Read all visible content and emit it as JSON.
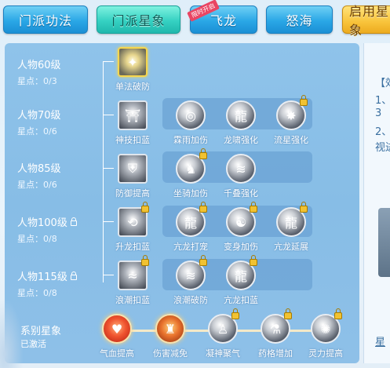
{
  "tabs": [
    {
      "label": "门派功法",
      "style": "blue"
    },
    {
      "label": "门派星象",
      "style": "active"
    },
    {
      "label": "飞龙",
      "style": "blue",
      "badge": "限时开启"
    },
    {
      "label": "怒海",
      "style": "blue"
    },
    {
      "label": "启用星象",
      "style": "yellow"
    }
  ],
  "rows": [
    {
      "level": "人物60级",
      "stars": "星点：0/3",
      "locked": false,
      "nodes": [
        {
          "label": "单法破防",
          "icon": "sword-burst-icon",
          "locked": false
        }
      ]
    },
    {
      "level": "人物70级",
      "stars": "星点：0/6",
      "locked": false,
      "nodes": [
        {
          "label": "神技扣蓝",
          "icon": "pagoda-icon",
          "locked": false
        },
        {
          "label": "霖雨加伤",
          "icon": "swirl-icon",
          "locked": false
        },
        {
          "label": "龙啸强化",
          "icon": "dragon-head-icon",
          "locked": false
        },
        {
          "label": "流星强化",
          "icon": "meteor-icon",
          "locked": true
        }
      ]
    },
    {
      "level": "人物85级",
      "stars": "星点：0/6",
      "locked": false,
      "nodes": [
        {
          "label": "防御提高",
          "icon": "shield-icon",
          "locked": false
        },
        {
          "label": "坐骑加伤",
          "icon": "mount-icon",
          "locked": true
        },
        {
          "label": "千叠强化",
          "icon": "wave-icon",
          "locked": false
        }
      ]
    },
    {
      "level": "人物100级",
      "stars": "星点：0/8",
      "locked": true,
      "nodes": [
        {
          "label": "升龙扣蓝",
          "icon": "rising-dragon-icon",
          "locked": true
        },
        {
          "label": "亢龙打宠",
          "icon": "coiled-dragon-icon",
          "locked": true
        },
        {
          "label": "变身加伤",
          "icon": "transform-icon",
          "locked": true
        },
        {
          "label": "亢龙延展",
          "icon": "dragon-extend-icon",
          "locked": true
        }
      ]
    },
    {
      "level": "人物115级",
      "stars": "星点：0/8",
      "locked": true,
      "nodes": [
        {
          "label": "浪潮扣蓝",
          "icon": "tide-icon",
          "locked": true
        },
        {
          "label": "浪潮破防",
          "icon": "tide-break-icon",
          "locked": true
        },
        {
          "label": "亢龙扣蓝",
          "icon": "dragon-mana-icon",
          "locked": true
        }
      ]
    }
  ],
  "series": {
    "title": "系别星象",
    "status": "已激活",
    "nodes": [
      {
        "label": "气血提高",
        "icon": "heart-icon",
        "locked": false
      },
      {
        "label": "伤害减免",
        "icon": "warrior-icon",
        "locked": false
      },
      {
        "label": "凝神聚气",
        "icon": "meditate-icon",
        "locked": true
      },
      {
        "label": "药格增加",
        "icon": "potion-icon",
        "locked": true
      },
      {
        "label": "灵力提高",
        "icon": "spirit-icon",
        "locked": true
      }
    ]
  },
  "right_panel": {
    "heading_fragment": "【效",
    "line1": "1、",
    "line2": "3",
    "line3": "2、",
    "line4": "视进",
    "footer_fragment": "星"
  },
  "colors": {
    "panel_bg": "#8fc3ea",
    "tab_active": "#35d1c2",
    "tab_blue": "#2aa7e6",
    "tab_yellow": "#f8c33a"
  }
}
